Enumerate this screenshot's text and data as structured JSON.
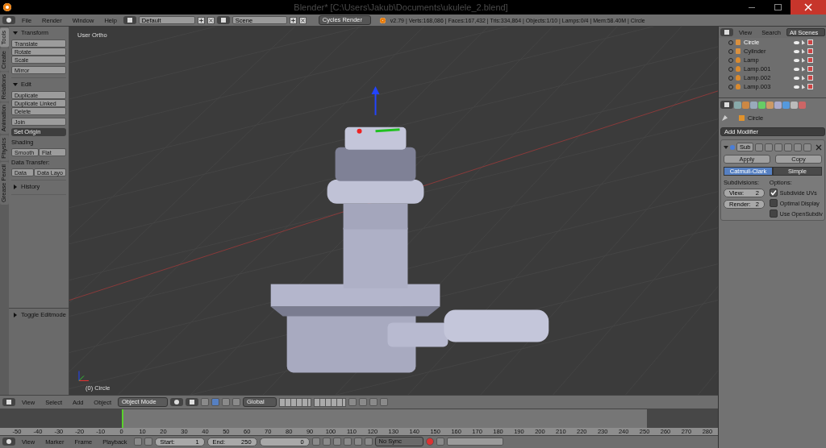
{
  "window": {
    "title": "Blender* [C:\\Users\\Jakub\\Documents\\ukulele_2.blend]"
  },
  "info_header": {
    "menus": [
      "File",
      "Render",
      "Window",
      "Help"
    ],
    "screen_layout": "Default",
    "scene": "Scene",
    "render_engine": "Cycles Render",
    "stats": "v2.79 | Verts:168,086 | Faces:167,432 | Tris:334,864 | Objects:1/10 | Lamps:0/4 | Mem:58.40M | Circle"
  },
  "tool_shelf": {
    "tabs": [
      {
        "label": "Tools",
        "selected": true
      },
      {
        "label": "Create",
        "selected": false
      },
      {
        "label": "Relations",
        "selected": false
      },
      {
        "label": "Animation",
        "selected": false
      },
      {
        "label": "Physics",
        "selected": false
      },
      {
        "label": "Grease Pencil",
        "selected": false
      }
    ],
    "panels": [
      {
        "title": "Transform",
        "expanded": true,
        "items": [
          {
            "kind": "stack",
            "buttons": [
              "Translate",
              "Rotate",
              "Scale"
            ]
          },
          {
            "kind": "stack",
            "buttons": [
              "Mirror"
            ]
          }
        ]
      },
      {
        "title": "Edit",
        "expanded": true,
        "items": [
          {
            "kind": "stack",
            "buttons": [
              "Duplicate",
              "Duplicate Linked",
              "Delete"
            ]
          },
          {
            "kind": "stack",
            "buttons": [
              "Join"
            ]
          },
          {
            "kind": "dropdown",
            "text": "Set Origin"
          },
          {
            "kind": "label",
            "text": "Shading"
          },
          {
            "kind": "row",
            "buttons": [
              "Smooth",
              "Flat"
            ]
          },
          {
            "kind": "label",
            "text": "Data Transfer:"
          },
          {
            "kind": "row",
            "buttons": [
              "Data",
              "Data Layo"
            ]
          }
        ]
      },
      {
        "title": "History",
        "expanded": false
      }
    ]
  },
  "operator_panel": {
    "title": "Toggle Editmode",
    "expanded": false
  },
  "viewport": {
    "view_name": "User Ortho",
    "object_label": "(0) Circle"
  },
  "viewport_header": {
    "menus": [
      "View",
      "Select",
      "Add",
      "Object"
    ],
    "mode": "Object Mode",
    "orientation": "Global"
  },
  "timeline": {
    "ruler": [
      "-50",
      "-40",
      "-30",
      "-20",
      "-10",
      "0",
      "10",
      "20",
      "30",
      "40",
      "50",
      "60",
      "70",
      "80",
      "90",
      "100",
      "110",
      "120",
      "130",
      "140",
      "150",
      "160",
      "170",
      "180",
      "190",
      "200",
      "210",
      "220",
      "230",
      "240",
      "250",
      "260",
      "270",
      "280"
    ]
  },
  "timeline_header": {
    "menus": [
      "View",
      "Marker",
      "Frame",
      "Playback"
    ],
    "start_label": "Start:",
    "start": "1",
    "end_label": "End:",
    "end": "250",
    "current": "0",
    "sync": "No Sync"
  },
  "outliner": {
    "menus": [
      "View",
      "Search"
    ],
    "filter": "All Scenes",
    "items": [
      {
        "name": "Circle",
        "kind": "mesh",
        "selected": true
      },
      {
        "name": "Cylinder",
        "kind": "mesh",
        "selected": false
      },
      {
        "name": "Lamp",
        "kind": "lamp",
        "selected": false
      },
      {
        "name": "Lamp.001",
        "kind": "lamp",
        "selected": false
      },
      {
        "name": "Lamp.002",
        "kind": "lamp",
        "selected": false
      },
      {
        "name": "Lamp.003",
        "kind": "lamp",
        "selected": false
      }
    ]
  },
  "properties": {
    "breadcrumb": "Circle",
    "add_modifier": "Add Modifier",
    "modifier": {
      "name": "Sub",
      "expanded": true,
      "apply": "Apply",
      "copy": "Copy",
      "types": [
        {
          "label": "Catmull-Clark",
          "selected": true
        },
        {
          "label": "Simple",
          "selected": false
        }
      ],
      "subdivisions_label": "Subdivisions:",
      "fields": [
        {
          "label": "View:",
          "value": "2"
        },
        {
          "label": "Render:",
          "value": "2"
        }
      ],
      "options_label": "Options:",
      "options": [
        {
          "label": "Subdivide UVs",
          "checked": true
        },
        {
          "label": "Optimal Display",
          "checked": false
        },
        {
          "label": "Use OpenSubdiv",
          "checked": false
        }
      ]
    }
  }
}
